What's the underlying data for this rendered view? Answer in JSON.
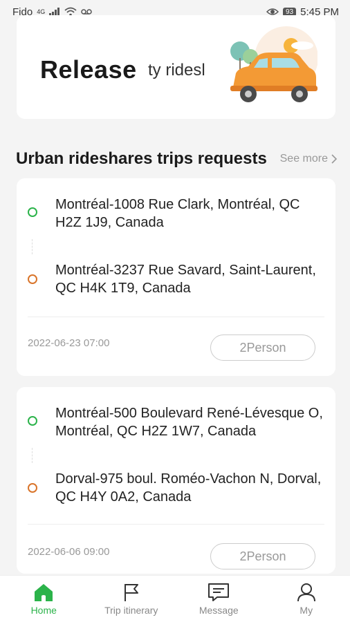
{
  "status_bar": {
    "carrier": "Fido",
    "network": "4G",
    "battery": "93",
    "time": "5:45 PM"
  },
  "banner": {
    "title": "Release",
    "subtitle": "ty ridesl"
  },
  "section": {
    "title": "Urban rideshares trips requests",
    "see_more": "See more"
  },
  "trips": [
    {
      "from": "Montréal-1008 Rue Clark, Montréal, QC H2Z 1J9, Canada",
      "to": "Montréal-3237 Rue Savard, Saint-Laurent, QC H4K 1T9, Canada",
      "datetime": "2022-06-23 07:00",
      "seats": "2Person"
    },
    {
      "from": "Montréal-500 Boulevard René-Lévesque O, Montréal, QC H2Z 1W7, Canada",
      "to": "Dorval-975 boul. Roméo-Vachon N, Dorval, QC H4Y 0A2, Canada",
      "datetime": "2022-06-06 09:00",
      "seats": "2Person"
    }
  ],
  "nav": [
    {
      "label": "Home",
      "icon": "home-icon",
      "active": true
    },
    {
      "label": "Trip itinerary",
      "icon": "flag-icon",
      "active": false
    },
    {
      "label": "Message",
      "icon": "message-icon",
      "active": false
    },
    {
      "label": "My",
      "icon": "person-icon",
      "active": false
    }
  ],
  "colors": {
    "accent": "#2bb34a",
    "destination": "#d9742a",
    "background": "#f4f4f4"
  }
}
